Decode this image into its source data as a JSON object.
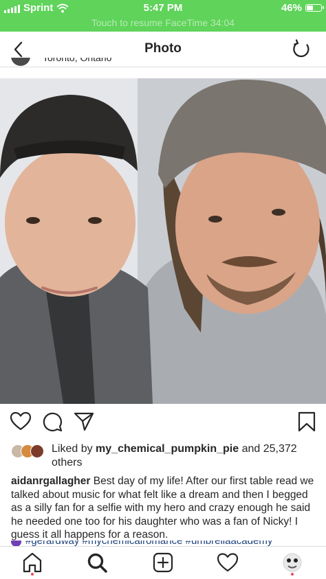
{
  "status_bar": {
    "carrier": "Sprint",
    "time": "5:47 PM",
    "battery": "46%",
    "battery_level": 0.46,
    "banner": "Touch to resume FaceTime 34:04"
  },
  "nav": {
    "title": "Photo",
    "back_icon": "chevron-left-icon",
    "refresh_icon": "refresh-icon"
  },
  "post": {
    "location": "Toronto, Ontario",
    "likes": {
      "prefix": "Liked by",
      "user": "my_chemical_pumpkin_pie",
      "suffix": "and 25,372 others"
    },
    "caption": {
      "username": "aidanrgallagher",
      "text": "Best day of my life!  After our first table read we talked about music for what felt like a dream and then I begged as a silly fan for a selfie with my hero and crazy enough he said he needed one too for his daughter who was a fan of Nicky!  I guess it all happens for a reason."
    },
    "hashtags": "#gerardway #mychemicalromance #umbrellaacademy"
  },
  "action_icons": [
    "heart-icon",
    "comment-icon",
    "share-icon",
    "bookmark-icon"
  ],
  "tab_icons": [
    "home-icon",
    "search-icon",
    "new-post-icon",
    "activity-heart-icon",
    "profile-avatar"
  ],
  "colors": {
    "status_green": "#5fd35a",
    "text": "#262626",
    "divider": "#dbdbdb",
    "hashtag": "#1a3f7a",
    "notification_dot": "#ed4956"
  }
}
